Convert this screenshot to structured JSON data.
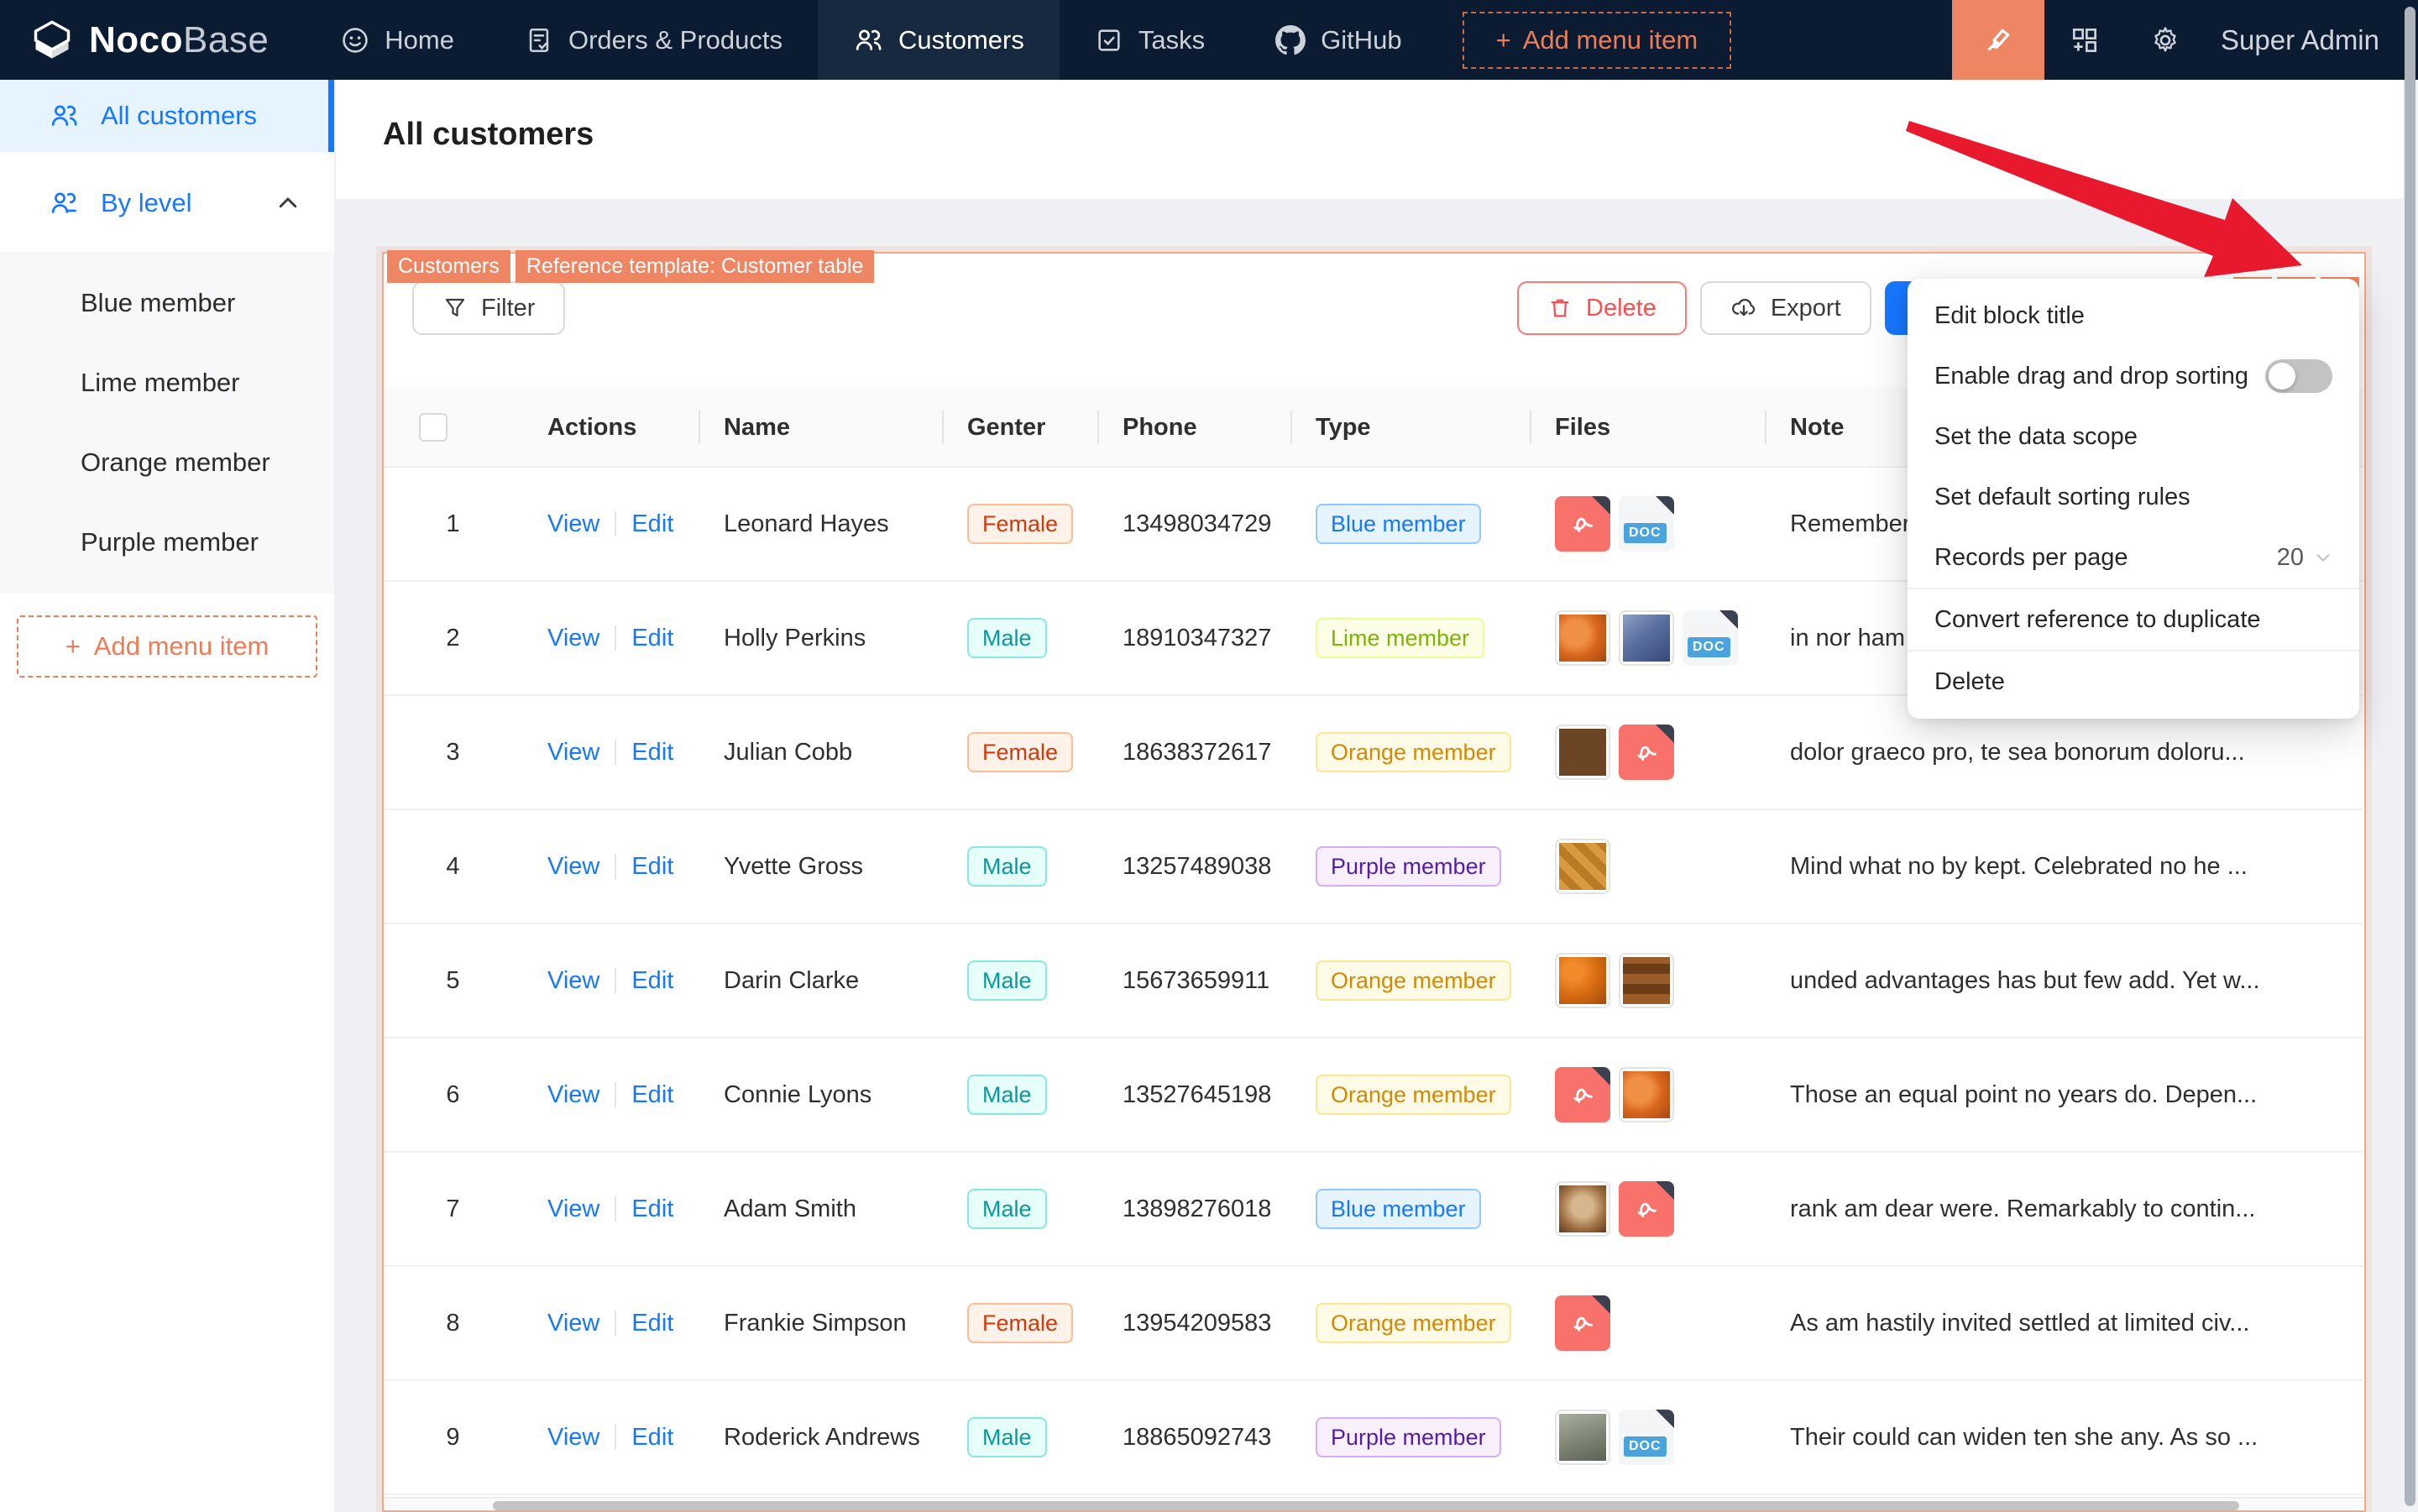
{
  "navbar": {
    "brand_bold": "Noco",
    "brand_light": "Base",
    "items": [
      {
        "label": "Home"
      },
      {
        "label": "Orders & Products"
      },
      {
        "label": "Customers"
      },
      {
        "label": "Tasks"
      },
      {
        "label": "GitHub"
      }
    ],
    "add_plus": "+",
    "add_label": "Add menu item",
    "user": "Super Admin"
  },
  "sidebar": {
    "all_customers": "All customers",
    "by_level": "By level",
    "sub": [
      {
        "label": "Blue member"
      },
      {
        "label": "Lime member"
      },
      {
        "label": "Orange member"
      },
      {
        "label": "Purple member"
      }
    ],
    "add_plus": "+",
    "add_label": "Add menu item"
  },
  "page": {
    "title": "All customers"
  },
  "block": {
    "tags": {
      "collection": "Customers",
      "template": "Reference template: Customer table"
    },
    "toolbar": {
      "filter": "Filter",
      "delete": "Delete",
      "export": "Export",
      "add": "+"
    }
  },
  "table": {
    "headers": {
      "actions": "Actions",
      "name": "Name",
      "gender": "Genter",
      "phone": "Phone",
      "type": "Type",
      "files": "Files",
      "note": "Note"
    },
    "action_labels": {
      "view": "View",
      "edit": "Edit"
    },
    "rows": [
      {
        "num": "1",
        "name": "Leonard Hayes",
        "gender": "Female",
        "gender_color": "volcano",
        "phone": "13498034729",
        "type": "Blue member",
        "type_color": "blue",
        "files": [
          {
            "kind": "pdf"
          },
          {
            "kind": "doc"
          }
        ],
        "note": "Remember"
      },
      {
        "num": "2",
        "name": "Holly Perkins",
        "gender": "Male",
        "gender_color": "cyan",
        "phone": "18910347327",
        "type": "Lime member",
        "type_color": "lime",
        "files": [
          {
            "kind": "img",
            "variant": "fruit"
          },
          {
            "kind": "img",
            "variant": "people"
          },
          {
            "kind": "doc"
          }
        ],
        "note": "in nor ham"
      },
      {
        "num": "3",
        "name": "Julian Cobb",
        "gender": "Female",
        "gender_color": "volcano",
        "phone": "18638372617",
        "type": "Orange member",
        "type_color": "gold",
        "files": [
          {
            "kind": "img",
            "variant": "food"
          },
          {
            "kind": "pdf"
          }
        ],
        "note": "dolor graeco pro, te sea bonorum doloru..."
      },
      {
        "num": "4",
        "name": "Yvette Gross",
        "gender": "Male",
        "gender_color": "cyan",
        "phone": "13257489038",
        "type": "Purple member",
        "type_color": "purple",
        "files": [
          {
            "kind": "img",
            "variant": "golden"
          }
        ],
        "note": "Mind what no by kept. Celebrated no he ..."
      },
      {
        "num": "5",
        "name": "Darin Clarke",
        "gender": "Male",
        "gender_color": "cyan",
        "phone": "15673659911",
        "type": "Orange member",
        "type_color": "gold",
        "files": [
          {
            "kind": "img",
            "variant": "oranges"
          },
          {
            "kind": "img",
            "variant": "kebab"
          }
        ],
        "note": "unded advantages has but few add. Yet w..."
      },
      {
        "num": "6",
        "name": "Connie Lyons",
        "gender": "Male",
        "gender_color": "cyan",
        "phone": "13527645198",
        "type": "Orange member",
        "type_color": "gold",
        "files": [
          {
            "kind": "pdf"
          },
          {
            "kind": "img",
            "variant": "fruit"
          }
        ],
        "note": "Those an equal point no years do. Depen..."
      },
      {
        "num": "7",
        "name": "Adam Smith",
        "gender": "Male",
        "gender_color": "cyan",
        "phone": "13898276018",
        "type": "Blue member",
        "type_color": "blue",
        "files": [
          {
            "kind": "img",
            "variant": "coffee"
          },
          {
            "kind": "pdf"
          }
        ],
        "note": "rank am dear were. Remarkably to contin..."
      },
      {
        "num": "8",
        "name": "Frankie Simpson",
        "gender": "Female",
        "gender_color": "volcano",
        "phone": "13954209583",
        "type": "Orange member",
        "type_color": "gold",
        "files": [
          {
            "kind": "pdf"
          }
        ],
        "note": "As am hastily invited settled at limited civ..."
      },
      {
        "num": "9",
        "name": "Roderick Andrews",
        "gender": "Male",
        "gender_color": "cyan",
        "phone": "18865092743",
        "type": "Purple member",
        "type_color": "purple",
        "files": [
          {
            "kind": "img",
            "variant": "street"
          },
          {
            "kind": "doc"
          }
        ],
        "note": "Their could can widen ten she any. As so ..."
      }
    ],
    "doc_label": "DOC"
  },
  "context_menu": {
    "items": {
      "edit_title": "Edit block title",
      "drag_sort": "Enable drag and drop sorting",
      "data_scope": "Set the data scope",
      "sort_rules": "Set default sorting rules",
      "records_per_page": "Records per page",
      "records_value": "20",
      "convert": "Convert reference to duplicate",
      "delete": "Delete"
    }
  },
  "colors": {
    "navbar_bg": "#0b1c32",
    "designer_orange": "#ee8663",
    "primary_blue": "#1677ff",
    "danger_red": "#ff4d4f",
    "arrow_red": "#e8192c",
    "selected_item_bg": "#e6f4ff"
  }
}
